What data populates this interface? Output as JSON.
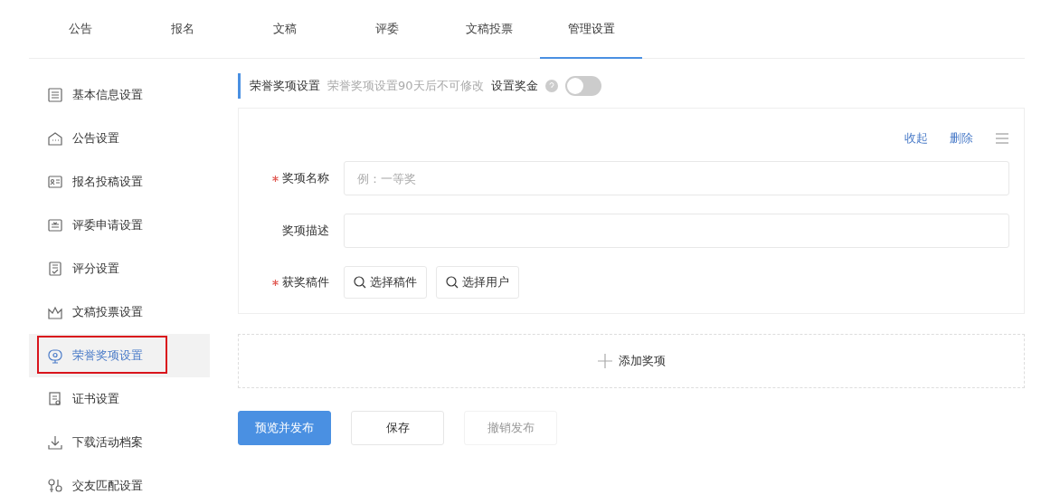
{
  "tabs": [
    {
      "label": "公告",
      "selected": false
    },
    {
      "label": "报名",
      "selected": false
    },
    {
      "label": "文稿",
      "selected": false
    },
    {
      "label": "评委",
      "selected": false
    },
    {
      "label": "文稿投票",
      "selected": false
    },
    {
      "label": "管理设置",
      "selected": true
    }
  ],
  "sidebar": {
    "items": [
      {
        "label": "基本信息设置",
        "selected": false,
        "outlined": false
      },
      {
        "label": "公告设置",
        "selected": false,
        "outlined": false
      },
      {
        "label": "报名投稿设置",
        "selected": false,
        "outlined": false
      },
      {
        "label": "评委申请设置",
        "selected": false,
        "outlined": false
      },
      {
        "label": "评分设置",
        "selected": false,
        "outlined": false
      },
      {
        "label": "文稿投票设置",
        "selected": false,
        "outlined": false
      },
      {
        "label": "荣誉奖项设置",
        "selected": true,
        "outlined": true
      },
      {
        "label": "证书设置",
        "selected": false,
        "outlined": false
      },
      {
        "label": "下载活动档案",
        "selected": false,
        "outlined": false
      },
      {
        "label": "交友匹配设置",
        "selected": false,
        "outlined": false
      }
    ]
  },
  "section": {
    "title": "荣誉奖项设置",
    "note": "荣誉奖项设置90天后不可修改",
    "bonus_label": "设置奖金",
    "bonus_on": false
  },
  "award_card": {
    "actions": [
      "收起",
      "删除"
    ],
    "fields": [
      {
        "label": "奖项名称",
        "required": true,
        "kind": "input",
        "placeholder": "例：一等奖"
      },
      {
        "label": "奖项描述",
        "required": false,
        "kind": "input"
      },
      {
        "label": "获奖稿件",
        "required": true,
        "kind": "buttons",
        "buttons": [
          "选择稿件",
          "选择用户"
        ]
      }
    ]
  },
  "add_award": "添加奖项",
  "buttons": [
    {
      "label": "预览并发布",
      "kind": "primary",
      "disabled": false
    },
    {
      "label": "保存",
      "kind": "default",
      "disabled": false
    },
    {
      "label": "撤销发布",
      "kind": "default",
      "disabled": true
    }
  ]
}
